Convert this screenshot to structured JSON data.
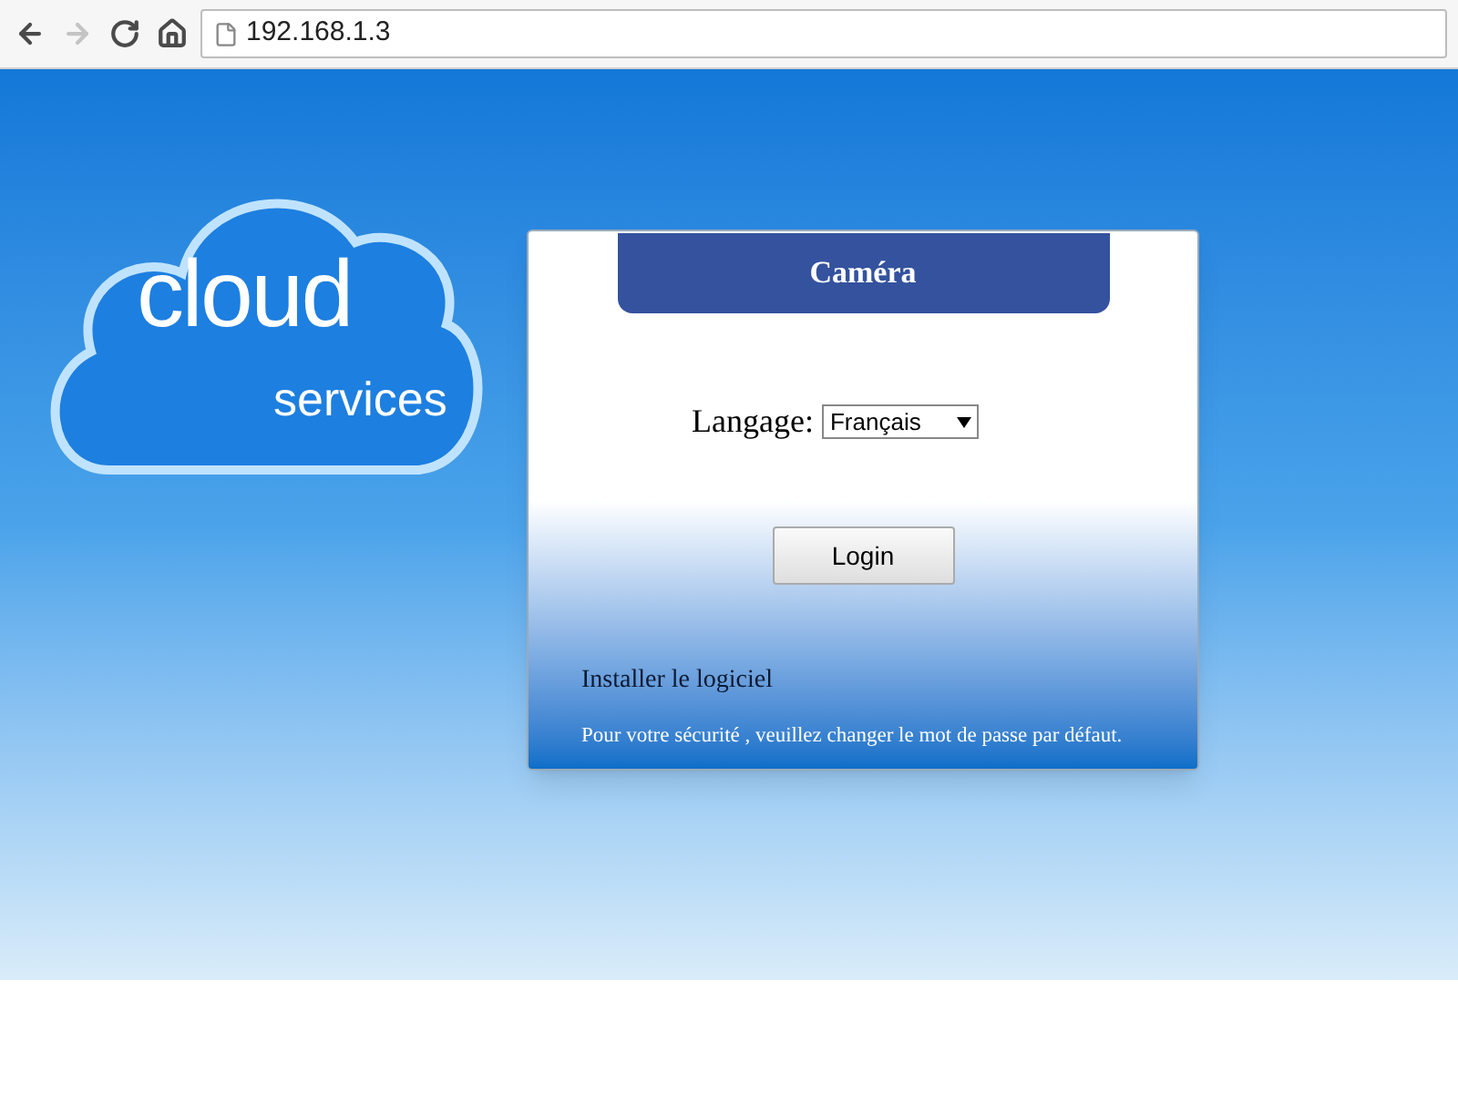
{
  "browser": {
    "nav_buttons": [
      {
        "kind": "back",
        "disabled": false
      },
      {
        "kind": "forward",
        "disabled": true
      },
      {
        "kind": "reload",
        "disabled": false
      },
      {
        "kind": "home",
        "disabled": false
      }
    ],
    "address": "192.168.1.3"
  },
  "logo": {
    "title": "cloud",
    "subtitle": "services"
  },
  "login_panel": {
    "header": "Caméra",
    "language_label": "Langage:",
    "language_value": "Français",
    "login_button": "Login",
    "install_link": "Installer le logiciel",
    "security_notice": "Pour votre sécurité , veuillez changer le mot de passe par défaut."
  }
}
